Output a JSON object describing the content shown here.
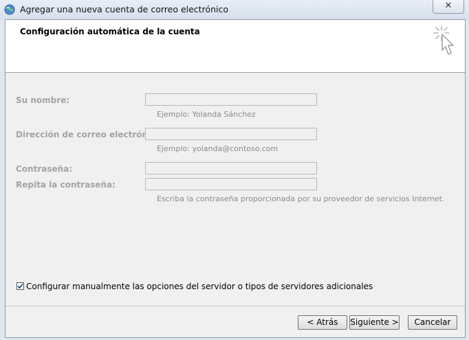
{
  "window": {
    "title": "Agregar una nueva cuenta de correo electrónico",
    "close_glyph": "✕"
  },
  "header": {
    "title": "Configuración automática de la cuenta",
    "icon": "cursor-sparkle-icon"
  },
  "form": {
    "name_label": "Su nombre:",
    "name_value": "",
    "name_hint": "Ejemplo: Yolanda Sánchez",
    "email_label": "Dirección de correo electrónico:",
    "email_value": "",
    "email_hint": "Ejemplo: yolanda@contoso.com",
    "password_label": "Contraseña:",
    "password_value": "",
    "repeat_label": "Repita la contraseña:",
    "repeat_value": "",
    "password_hint": "Escriba la contraseña proporcionada por su proveedor de servicios Internet."
  },
  "manual_config": {
    "label": "Configurar manualmente las opciones del servidor o tipos de servidores adicionales",
    "checked": true
  },
  "buttons": {
    "back": "< Atrás",
    "next": "Siguiente >",
    "cancel": "Cancelar"
  }
}
